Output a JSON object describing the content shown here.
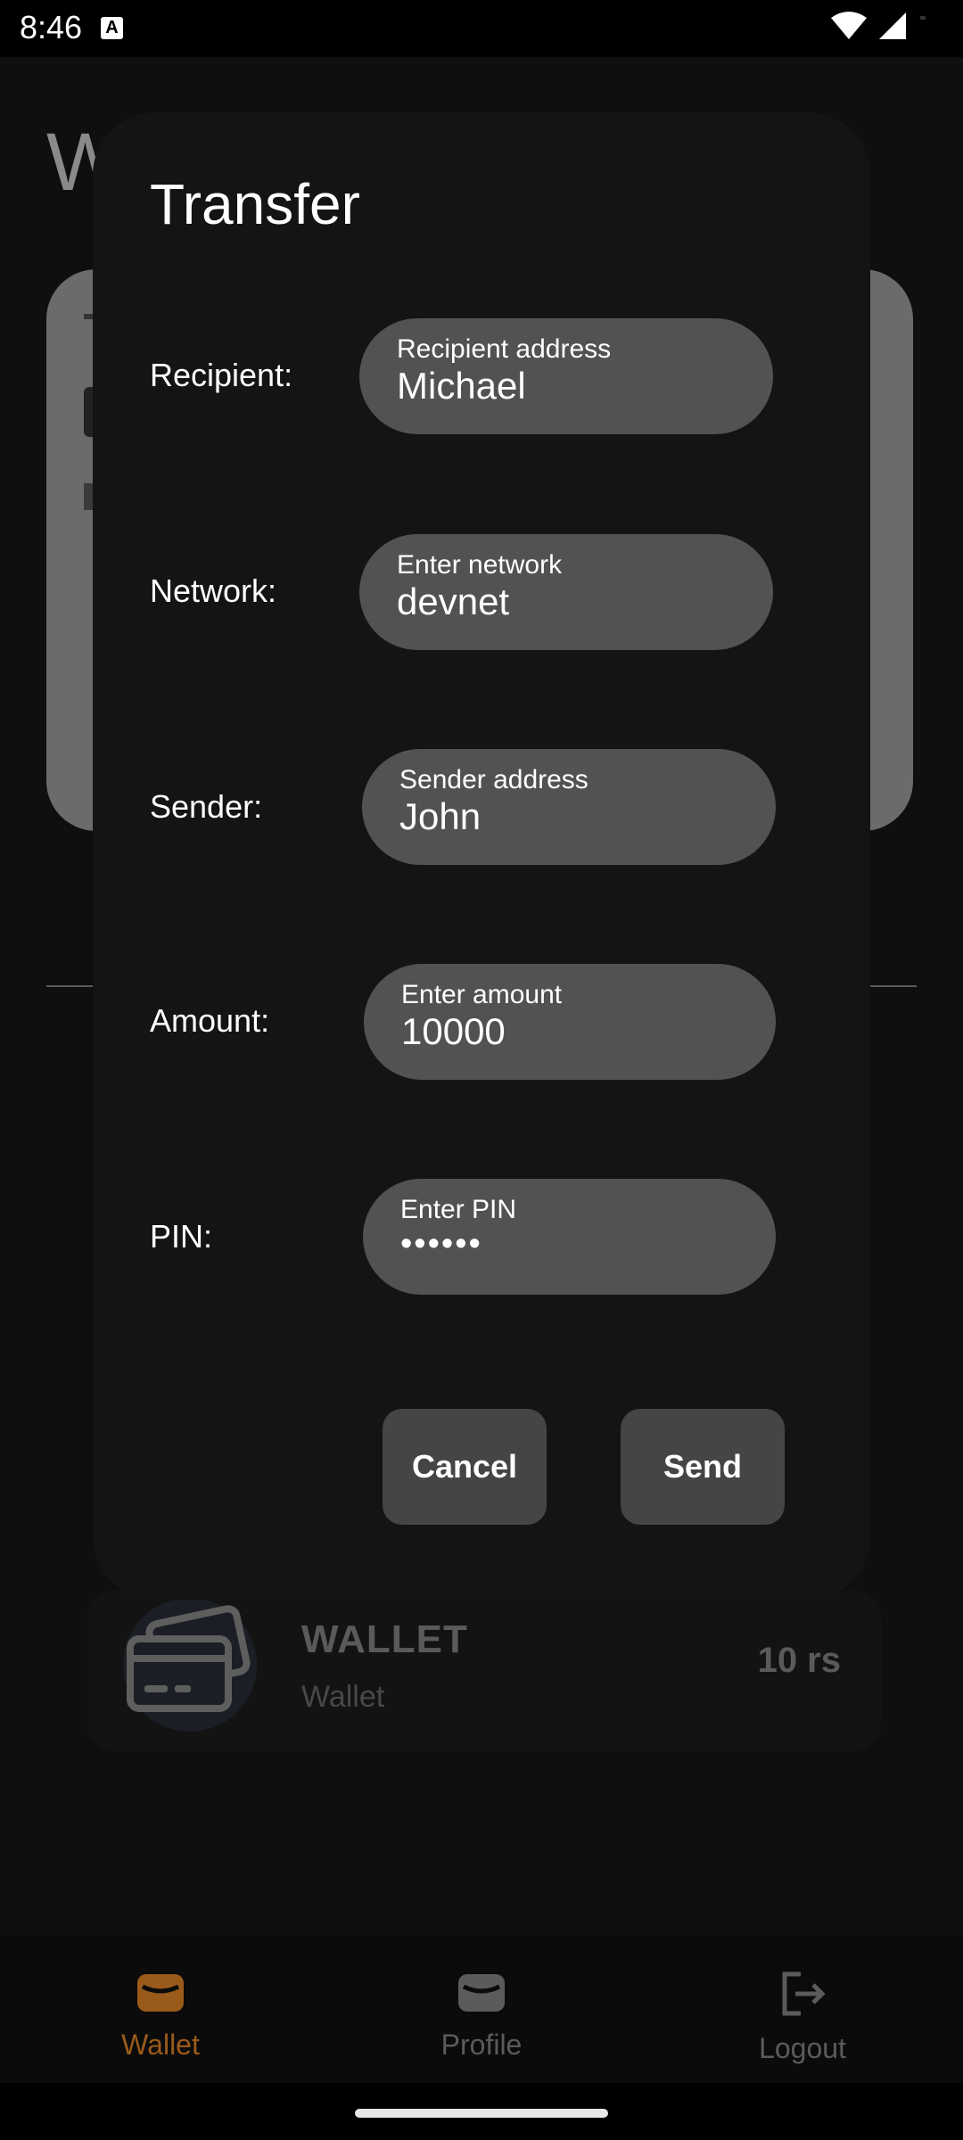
{
  "status_bar": {
    "time": "8:46"
  },
  "background": {
    "page_title": "W",
    "wallet_item": {
      "name": "WALLET",
      "subtitle": "Wallet",
      "amount": "10 rs"
    }
  },
  "dialog": {
    "title": "Transfer",
    "rows": [
      {
        "label": "Recipient:",
        "placeholder": "Recipient address",
        "value": "Michael"
      },
      {
        "label": "Network:",
        "placeholder": "Enter network",
        "value": "devnet"
      },
      {
        "label": "Sender:",
        "placeholder": "Sender address",
        "value": "John"
      },
      {
        "label": "Amount:",
        "placeholder": "Enter amount",
        "value": "10000"
      },
      {
        "label": "PIN:",
        "placeholder": "Enter PIN",
        "value": "••••••"
      }
    ],
    "cancel_label": "Cancel",
    "send_label": "Send"
  },
  "bottom_nav": {
    "items": [
      {
        "label": "Wallet",
        "icon": "wallet-icon",
        "active": true
      },
      {
        "label": "Profile",
        "icon": "wallet-icon",
        "active": false
      },
      {
        "label": "Logout",
        "icon": "logout-icon",
        "active": false
      }
    ]
  },
  "colors": {
    "accent": "#9a5a1a",
    "dialog_bg": "#141414",
    "field_bg": "#525252",
    "button_bg": "#454545"
  }
}
